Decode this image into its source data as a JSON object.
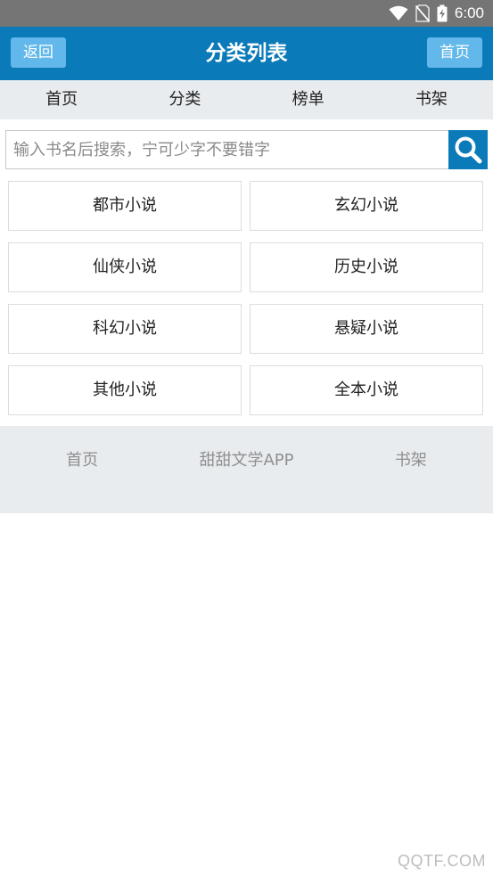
{
  "status_bar": {
    "time": "6:00",
    "icons": [
      "wifi-icon",
      "no-sim-icon",
      "battery-charging-icon"
    ]
  },
  "header": {
    "back_label": "返回",
    "title": "分类列表",
    "home_label": "首页",
    "background": "#0b7ab8",
    "button_color": "#62b8ea"
  },
  "nav": {
    "items": [
      {
        "label": "首页"
      },
      {
        "label": "分类"
      },
      {
        "label": "榜单"
      },
      {
        "label": "书架"
      }
    ]
  },
  "search": {
    "placeholder": "输入书名后搜索，宁可少字不要错字",
    "value": "",
    "icon": "search-icon"
  },
  "categories": [
    {
      "label": "都市小说"
    },
    {
      "label": "玄幻小说"
    },
    {
      "label": "仙侠小说"
    },
    {
      "label": "历史小说"
    },
    {
      "label": "科幻小说"
    },
    {
      "label": "悬疑小说"
    },
    {
      "label": "其他小说"
    },
    {
      "label": "全本小说"
    }
  ],
  "footer": {
    "links": [
      {
        "label": "首页"
      },
      {
        "label": "甜甜文学APP"
      },
      {
        "label": "书架"
      }
    ]
  },
  "watermark": "QQTF.COM"
}
